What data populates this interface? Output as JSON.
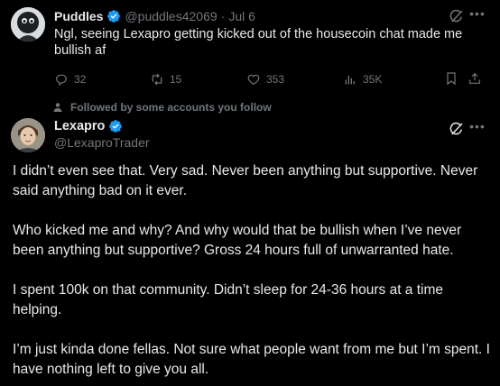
{
  "tweet1": {
    "author_name": "Puddles",
    "handle": "@puddles42069",
    "separator": "·",
    "date": "Jul 6",
    "text": "Ngl, seeing Lexapro getting kicked out of the housecoin chat made me bullish af",
    "replies": "32",
    "reposts": "15",
    "likes": "353",
    "views": "35K"
  },
  "social_context": "Followed by some accounts you follow",
  "tweet2": {
    "author_name": "Lexapro",
    "handle": "@LexaproTrader",
    "paragraphs": [
      "I didn’t even see that. Very sad. Never been anything but supportive. Never said anything bad on it ever.",
      "Who kicked me and why? And why would that be bullish when I’ve never been anything but supportive? Gross 24 hours full of unwarranted hate.",
      "I spent 100k on that community. Didn’t sleep for 24-36 hours at a time helping.",
      "I’m just kinda done fellas. Not sure what people want from me but I’m spent. I have nothing left to give you all."
    ]
  },
  "colors": {
    "background": "#000000",
    "primary_text": "#e7e9ea",
    "secondary_text": "#71767b",
    "verified_blue": "#1d9bf0"
  },
  "icons": [
    "verified-badge-icon",
    "grok-icon",
    "more-icon",
    "reply-icon",
    "repost-icon",
    "like-icon",
    "views-icon",
    "bookmark-icon",
    "share-icon",
    "person-icon"
  ]
}
